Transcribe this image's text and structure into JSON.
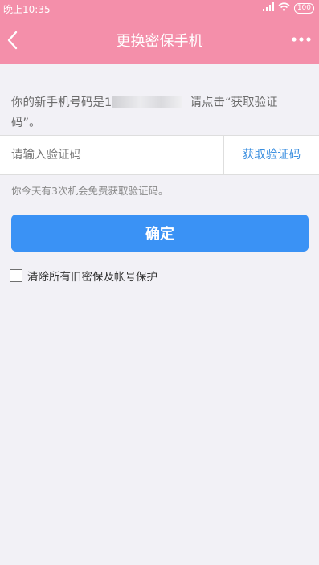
{
  "status_bar": {
    "time": "晚上10:35",
    "battery": "100"
  },
  "header": {
    "title": "更换密保手机",
    "back_icon": "chevron-left-icon",
    "more_icon": "more-dots-icon",
    "background": "#f48faa"
  },
  "notice": {
    "prefix": "你的新手机号码是1",
    "suffix": "请点击“获取验证码”。"
  },
  "code_field": {
    "placeholder": "请输入验证码",
    "get_code_label": "获取验证码"
  },
  "chance_text": "你今天有3次机会免费获取验证码。",
  "confirm_label": "确定",
  "clear_option": {
    "label": "清除所有旧密保及帐号保护",
    "checked": false
  },
  "colors": {
    "accent": "#3a92f5",
    "link": "#3b8fe0",
    "background": "#f2f1f6"
  }
}
